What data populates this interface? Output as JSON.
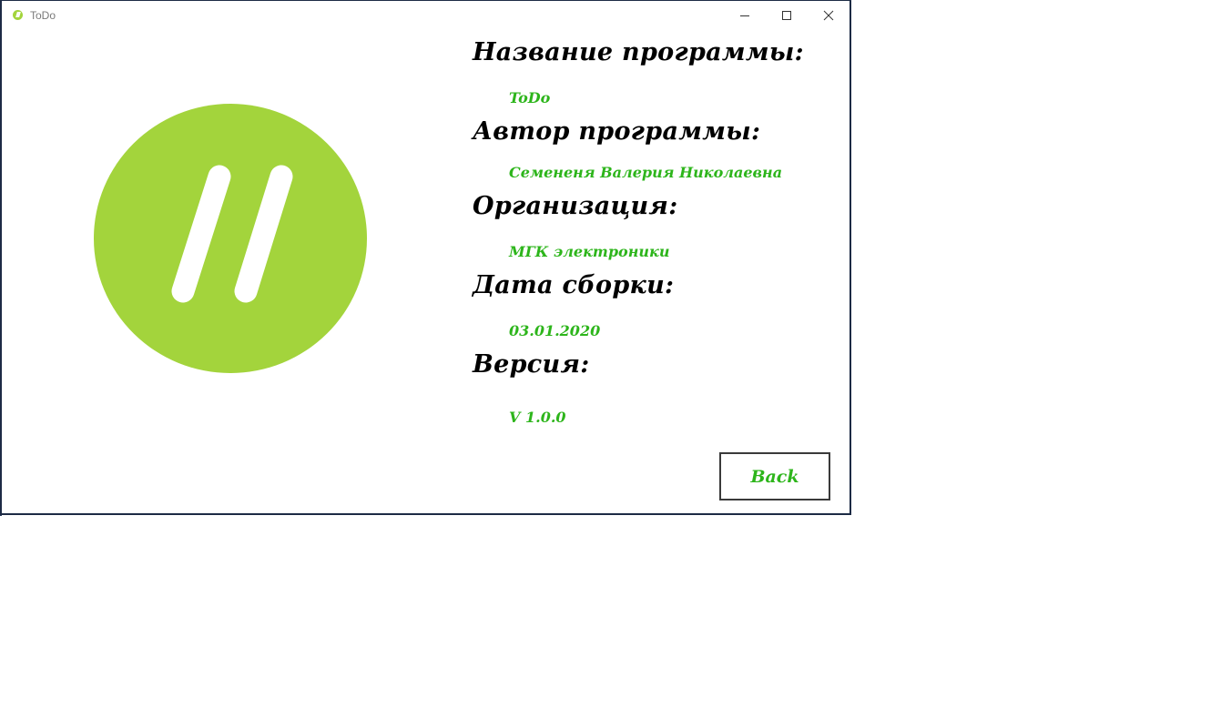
{
  "window": {
    "title": "ToDo",
    "app_icon": "todo-logo-icon",
    "controls": {
      "minimize_icon": "minimize-icon",
      "maximize_icon": "maximize-icon",
      "close_icon": "close-icon"
    }
  },
  "logo": {
    "icon": "todo-logo-icon",
    "color": "#a3d43c"
  },
  "info": {
    "program_name_label": "Название программы:",
    "program_name_value": "ToDo",
    "author_label": "Автор программы:",
    "author_value": "Семененя Валерия Николаевна",
    "organization_label": "Организация:",
    "organization_value": "МГК электроники",
    "build_date_label": "Дата сборки:",
    "build_date_value": "03.01.2020",
    "version_label": "Версия:",
    "version_value": "V 1.0.0"
  },
  "actions": {
    "back_label": "Back"
  },
  "colors": {
    "heading": "#000000",
    "value": "#2db51b",
    "accent": "#a3d43c"
  }
}
